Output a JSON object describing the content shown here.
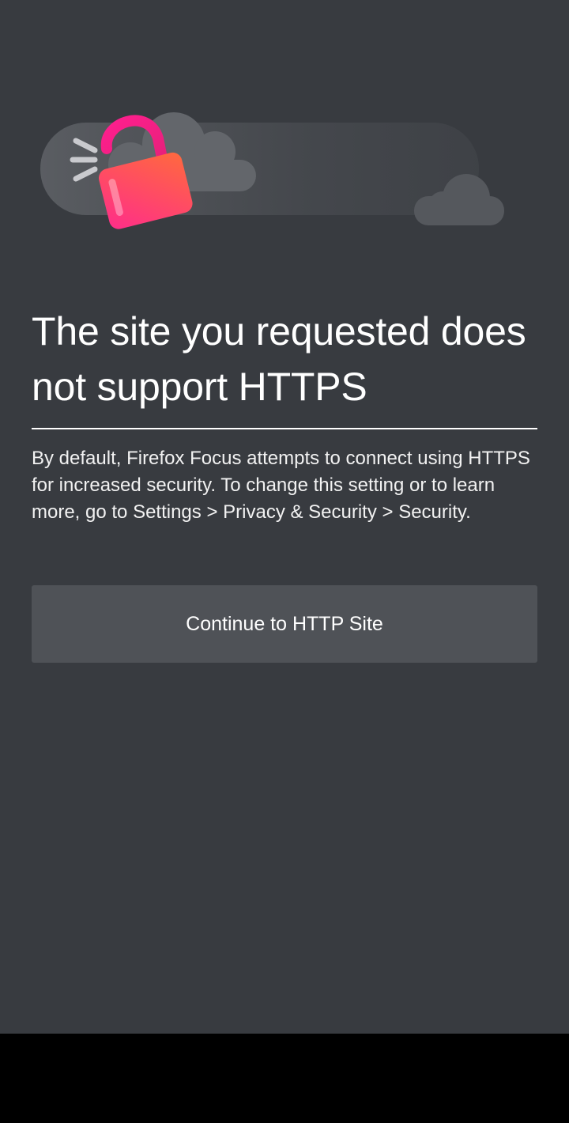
{
  "error_page": {
    "title": "The site you requested does not support HTTPS",
    "description": "By default, Firefox Focus attempts to connect using HTTPS for increased security. To change this setting or to learn more, go to Settings > Privacy & Security > Security.",
    "continue_button_label": "Continue to HTTP Site"
  },
  "illustration": {
    "icon": "unlocked-padlock-icon",
    "background": "cloud-icon"
  },
  "colors": {
    "background": "#383b40",
    "button": "#4f5257",
    "text": "#ffffff",
    "lock_gradient_start": "#ff2d8a",
    "lock_gradient_end": "#ff6a3d"
  }
}
